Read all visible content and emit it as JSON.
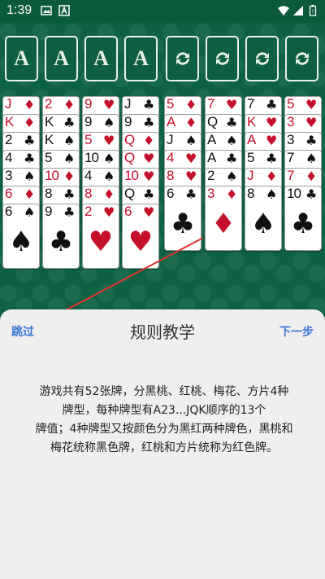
{
  "status": {
    "time": "1:39"
  },
  "foundations": [
    "A",
    "A",
    "A",
    "A"
  ],
  "freecells": [
    "refresh-icon",
    "refresh-icon",
    "refresh-icon",
    "refresh-icon"
  ],
  "colors": {
    "red": "#c4102a",
    "black": "#111111",
    "felt": "#0e6244",
    "link": "#3c74d4"
  },
  "tableau": [
    [
      {
        "rank": "J",
        "suit": "♦",
        "color": "red"
      },
      {
        "rank": "K",
        "suit": "♦",
        "color": "red"
      },
      {
        "rank": "2",
        "suit": "♣",
        "color": "black"
      },
      {
        "rank": "4",
        "suit": "♣",
        "color": "black"
      },
      {
        "rank": "3",
        "suit": "♠",
        "color": "black"
      },
      {
        "rank": "6",
        "suit": "♦",
        "color": "red"
      },
      {
        "rank": "6",
        "suit": "♠",
        "color": "black"
      }
    ],
    [
      {
        "rank": "2",
        "suit": "♦",
        "color": "red"
      },
      {
        "rank": "K",
        "suit": "♣",
        "color": "black"
      },
      {
        "rank": "K",
        "suit": "♠",
        "color": "black"
      },
      {
        "rank": "5",
        "suit": "♠",
        "color": "black"
      },
      {
        "rank": "10",
        "suit": "♦",
        "color": "red"
      },
      {
        "rank": "8",
        "suit": "♣",
        "color": "black"
      },
      {
        "rank": "9",
        "suit": "♣",
        "color": "black"
      }
    ],
    [
      {
        "rank": "9",
        "suit": "♥",
        "color": "red"
      },
      {
        "rank": "9",
        "suit": "♠",
        "color": "black"
      },
      {
        "rank": "5",
        "suit": "♥",
        "color": "red"
      },
      {
        "rank": "10",
        "suit": "♠",
        "color": "black"
      },
      {
        "rank": "4",
        "suit": "♠",
        "color": "black"
      },
      {
        "rank": "8",
        "suit": "♦",
        "color": "red"
      },
      {
        "rank": "2",
        "suit": "♥",
        "color": "red"
      }
    ],
    [
      {
        "rank": "J",
        "suit": "♣",
        "color": "black"
      },
      {
        "rank": "9",
        "suit": "♣",
        "color": "black"
      },
      {
        "rank": "Q",
        "suit": "♦",
        "color": "red"
      },
      {
        "rank": "Q",
        "suit": "♥",
        "color": "red"
      },
      {
        "rank": "10",
        "suit": "♥",
        "color": "red"
      },
      {
        "rank": "Q",
        "suit": "♣",
        "color": "black"
      },
      {
        "rank": "6",
        "suit": "♥",
        "color": "red"
      }
    ],
    [
      {
        "rank": "5",
        "suit": "♦",
        "color": "red"
      },
      {
        "rank": "A",
        "suit": "♦",
        "color": "red"
      },
      {
        "rank": "J",
        "suit": "♠",
        "color": "black"
      },
      {
        "rank": "4",
        "suit": "♥",
        "color": "red"
      },
      {
        "rank": "8",
        "suit": "♥",
        "color": "red"
      },
      {
        "rank": "6",
        "suit": "♣",
        "color": "black"
      }
    ],
    [
      {
        "rank": "7",
        "suit": "♥",
        "color": "red"
      },
      {
        "rank": "Q",
        "suit": "♣",
        "color": "black"
      },
      {
        "rank": "A",
        "suit": "♠",
        "color": "black"
      },
      {
        "rank": "A",
        "suit": "♣",
        "color": "black"
      },
      {
        "rank": "2",
        "suit": "♠",
        "color": "black"
      },
      {
        "rank": "3",
        "suit": "♦",
        "color": "red"
      }
    ],
    [
      {
        "rank": "7",
        "suit": "♣",
        "color": "black"
      },
      {
        "rank": "K",
        "suit": "♥",
        "color": "red"
      },
      {
        "rank": "A",
        "suit": "♥",
        "color": "red"
      },
      {
        "rank": "5",
        "suit": "♣",
        "color": "black"
      },
      {
        "rank": "J",
        "suit": "♦",
        "color": "red"
      },
      {
        "rank": "8",
        "suit": "♠",
        "color": "black"
      }
    ],
    [
      {
        "rank": "5",
        "suit": "♥",
        "color": "red"
      },
      {
        "rank": "3",
        "suit": "♥",
        "color": "red"
      },
      {
        "rank": "3",
        "suit": "♣",
        "color": "black"
      },
      {
        "rank": "7",
        "suit": "♠",
        "color": "black"
      },
      {
        "rank": "7",
        "suit": "♦",
        "color": "red"
      },
      {
        "rank": "10",
        "suit": "♣",
        "color": "black"
      }
    ]
  ],
  "tutorial": {
    "skip_label": "跳过",
    "title": "规则教学",
    "next_label": "下一步",
    "line1": "游戏共有52张牌，分黑桃、红桃、梅花、方片4种",
    "line2": "牌型，每种牌型有A23...JQK顺序的13个",
    "line3": "牌值；4种牌型又按颜色分为黑红两种牌色，黑桃和",
    "line4": "梅花统称黑色牌，红桃和方片统称为红色牌。"
  }
}
